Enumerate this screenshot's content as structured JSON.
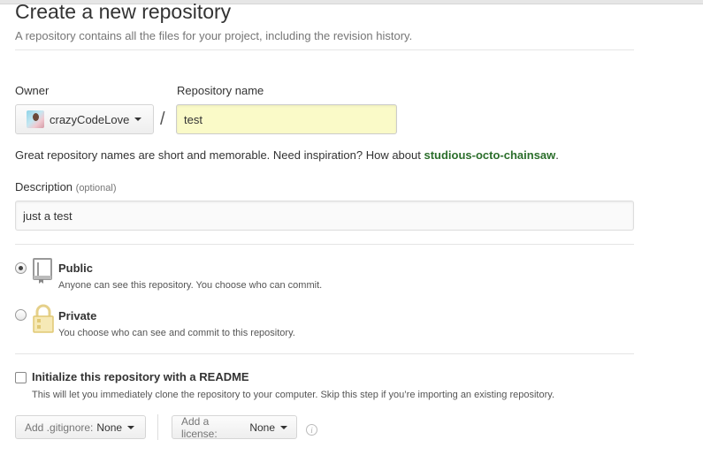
{
  "header": {
    "title": "Create a new repository",
    "subtitle": "A repository contains all the files for your project, including the revision history."
  },
  "owner": {
    "label": "Owner",
    "value": "crazyCodeLove"
  },
  "repo": {
    "label": "Repository name",
    "separator": "/",
    "value": "test"
  },
  "hint": {
    "text": "Great repository names are short and memorable. Need inspiration? How about",
    "suggestion": "studious-octo-chainsaw",
    "end": "."
  },
  "description": {
    "label": "Description",
    "optional": "(optional)",
    "value": "just a test"
  },
  "visibility": {
    "public": {
      "title": "Public",
      "note": "Anyone can see this repository. You choose who can commit.",
      "selected": true
    },
    "private": {
      "title": "Private",
      "note": "You choose who can see and commit to this repository.",
      "selected": false
    }
  },
  "readme": {
    "title": "Initialize this repository with a README",
    "note": "This will let you immediately clone the repository to your computer. Skip this step if you’re importing an existing repository.",
    "checked": false
  },
  "gitignore": {
    "label": "Add .gitignore:",
    "value": "None"
  },
  "license": {
    "label": "Add a license:",
    "value": "None"
  },
  "icons": {
    "info": "i"
  }
}
